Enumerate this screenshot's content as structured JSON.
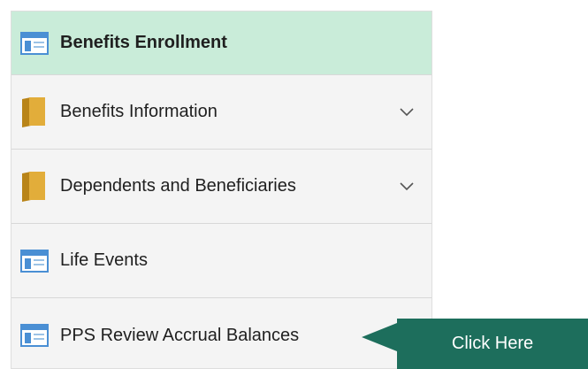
{
  "nav": {
    "items": [
      {
        "label": "Benefits Enrollment",
        "icon": "page-icon",
        "active": true,
        "expandable": false
      },
      {
        "label": "Benefits Information",
        "icon": "folder-icon",
        "active": false,
        "expandable": true
      },
      {
        "label": "Dependents and Beneficiaries",
        "icon": "folder-icon",
        "active": false,
        "expandable": true
      },
      {
        "label": "Life Events",
        "icon": "page-icon",
        "active": false,
        "expandable": false
      },
      {
        "label": "PPS Review Accrual Balances",
        "icon": "page-icon",
        "active": false,
        "expandable": false
      }
    ]
  },
  "callout": {
    "label": "Click Here"
  },
  "colors": {
    "active_bg": "#c9ecd9",
    "nav_bg": "#f4f4f4",
    "callout_bg": "#1d6e5c",
    "folder": "#d9a531",
    "page_icon_blue": "#4a8fd4"
  }
}
